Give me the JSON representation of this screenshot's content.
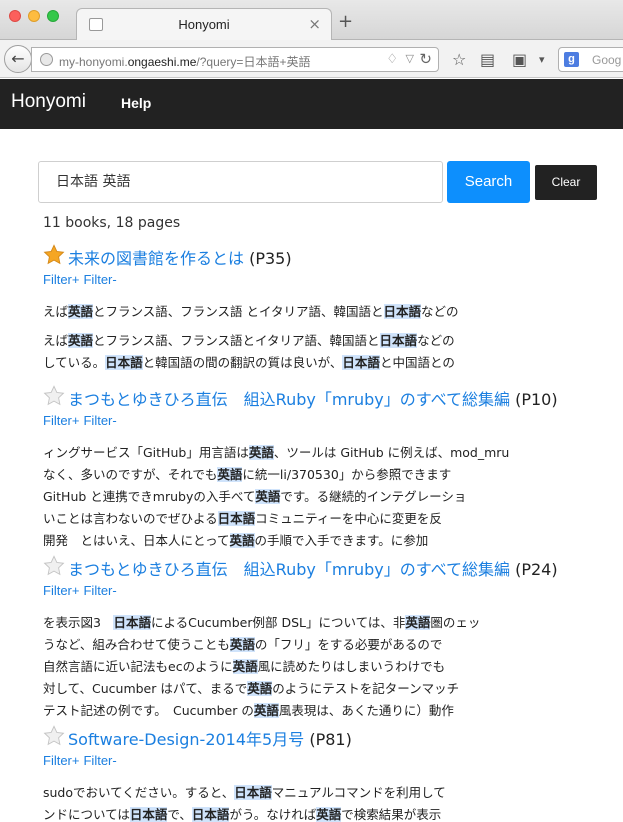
{
  "browser": {
    "tab_title": "Honyomi",
    "new_tab": "+",
    "close_tab": "×",
    "url_host": "my-honyomi.",
    "url_domain": "ongaeshi.me",
    "url_path": "/?query=日本語+英語",
    "search_engine_label": "Goog"
  },
  "app": {
    "brand": "Honyomi",
    "help": "Help"
  },
  "search": {
    "query": "日本語 英語",
    "search_button": "Search",
    "clear_button": "Clear"
  },
  "summary": "11 books, 18 pages",
  "filters": {
    "plus": "Filter+",
    "minus": "Filter-"
  },
  "results": [
    {
      "starred": true,
      "title": "未来の図書館を作るとは",
      "page": "(P35)",
      "snippets": [
        [
          [
            [
              "えば",
              ""
            ],
            [
              "英語",
              "h"
            ],
            [
              "とフランス語、フランス語 とイタリア語、韓国語と",
              ""
            ],
            [
              "日本語",
              "h"
            ],
            [
              "などの",
              ""
            ]
          ]
        ],
        [
          [
            [
              "えば",
              ""
            ],
            [
              "英語",
              "h"
            ],
            [
              "とフランス語、フランス語とイタリア語、韓国語と",
              ""
            ],
            [
              "日本語",
              "h"
            ],
            [
              "などの",
              ""
            ]
          ],
          [
            [
              "している。",
              ""
            ],
            [
              "日本語",
              "h"
            ],
            [
              "と韓国語の間の翻訳の質は良いが、",
              ""
            ],
            [
              "日本語",
              "h"
            ],
            [
              "と中国語との",
              ""
            ]
          ]
        ]
      ]
    },
    {
      "starred": false,
      "title": "まつもとゆきひろ直伝　組込Ruby「mruby」のすべて総集編",
      "page": "(P10)",
      "snippets": [
        [
          [
            [
              "ィングサービス「GitHub」用言語は",
              ""
            ],
            [
              "英語",
              "h"
            ],
            [
              "、ツールは GitHub に例えば、mod_mru",
              ""
            ]
          ],
          [
            [
              "なく、多いのですが、それでも",
              ""
            ],
            [
              "英語",
              "h"
            ],
            [
              "に統一li/370530」から参照できます",
              ""
            ]
          ],
          [
            [
              "GitHub と連携できmrubyの入手べて",
              ""
            ],
            [
              "英語",
              "h"
            ],
            [
              "です。る継続的インテグレーショ",
              ""
            ]
          ],
          [
            [
              "いことは言わないのでぜひよる",
              ""
            ],
            [
              "日本語",
              "h"
            ],
            [
              "コミュニティーを中心に変更を反",
              ""
            ]
          ],
          [
            [
              "開発　とはいえ、日本人にとって",
              ""
            ],
            [
              "英語",
              "h"
            ],
            [
              "の手順で入手できます。に参加",
              ""
            ]
          ]
        ]
      ]
    },
    {
      "starred": false,
      "title": "まつもとゆきひろ直伝　組込Ruby「mruby」のすべて総集編",
      "page": "(P24)",
      "snippets": [
        [
          [
            [
              "を表示図3　",
              ""
            ],
            [
              "日本語",
              "h"
            ],
            [
              "によるCucumber例部 DSL」については、非",
              ""
            ],
            [
              "英語",
              "h"
            ],
            [
              "圏のェッ",
              ""
            ]
          ],
          [
            [
              "うなど、組み合わせて使うことも",
              ""
            ],
            [
              "英語",
              "h"
            ],
            [
              "の「フリ」をする必要があるので",
              ""
            ]
          ],
          [
            [
              "自然言語に近い記法もecのように",
              ""
            ],
            [
              "英語",
              "h"
            ],
            [
              "風に読めたりはしまいうわけでも",
              ""
            ]
          ],
          [
            [
              "対して、Cucumber はパて、まるで",
              ""
            ],
            [
              "英語",
              "h"
            ],
            [
              "のようにテストを記ターンマッチ",
              ""
            ]
          ],
          [
            [
              "テスト記述の例です。　Cucumber の",
              ""
            ],
            [
              "英語",
              "h"
            ],
            [
              "風表現は、あくた通りに）動作",
              ""
            ]
          ]
        ]
      ]
    },
    {
      "starred": false,
      "title": "Software-Design-2014年5月号",
      "page": "(P81)",
      "snippets": [
        [
          [
            [
              "sudoでおいてください。すると、",
              ""
            ],
            [
              "日本語",
              "h"
            ],
            [
              "マニュアルコマンドを利用して",
              ""
            ]
          ],
          [
            [
              "ンドについては",
              ""
            ],
            [
              "日本語",
              "h"
            ],
            [
              "で、",
              ""
            ],
            [
              "日本語",
              "h"
            ],
            [
              "がう。なければ",
              ""
            ],
            [
              "英語",
              "h"
            ],
            [
              "で検索結果が表示",
              ""
            ]
          ]
        ]
      ]
    }
  ],
  "colors": {
    "link": "#1b7fe0",
    "highlight": "#cfe3fb",
    "primary": "#0d8ffd",
    "navbar": "#222222",
    "star_gold": "#f5a623"
  },
  "icons": {
    "star_filled": "star-filled-icon",
    "star_empty": "star-empty-icon"
  }
}
